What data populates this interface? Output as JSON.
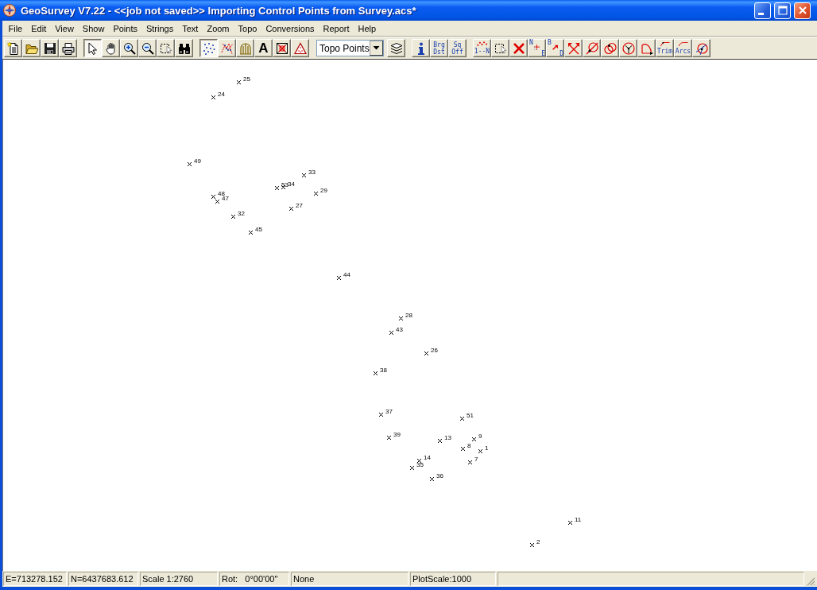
{
  "window": {
    "title": "GeoSurvey V7.22 - <<job not saved>> Importing Control Points from Survey.acs*"
  },
  "menu": [
    "File",
    "Edit",
    "View",
    "Show",
    "Points",
    "Strings",
    "Text",
    "Zoom",
    "Topo",
    "Conversions",
    "Report",
    "Help"
  ],
  "toolbar": {
    "groups": [
      {
        "items": [
          {
            "kind": "new",
            "pressed": false
          },
          {
            "kind": "open",
            "pressed": false
          },
          {
            "kind": "save",
            "pressed": false
          },
          {
            "kind": "print",
            "pressed": false
          }
        ]
      },
      {
        "items": [
          {
            "kind": "select",
            "pressed": true
          },
          {
            "kind": "pan",
            "pressed": false
          },
          {
            "kind": "zoomin",
            "pressed": false
          },
          {
            "kind": "zoomout",
            "pressed": false
          },
          {
            "kind": "zoomwindow",
            "pressed": false
          },
          {
            "kind": "find",
            "pressed": false
          }
        ]
      },
      {
        "items": [
          {
            "kind": "points",
            "pressed": true
          },
          {
            "kind": "strings",
            "pressed": false
          },
          {
            "kind": "topo",
            "pressed": false
          },
          {
            "kind": "text",
            "pressed": false,
            "text": [
              "A"
            ]
          },
          {
            "kind": "delete",
            "pressed": false
          },
          {
            "kind": "triangle",
            "pressed": false
          }
        ]
      },
      {
        "items": [
          {
            "kind": "dropdown",
            "value": "Topo Points"
          },
          {
            "kind": "layers",
            "pressed": false
          }
        ]
      },
      {
        "items": [
          {
            "kind": "info",
            "pressed": false
          },
          {
            "kind": "brgdst",
            "pressed": false,
            "text": [
              "Brg",
              "Dst"
            ]
          },
          {
            "kind": "sqoff",
            "pressed": false,
            "text": [
              "Sq",
              "Off"
            ]
          }
        ]
      },
      {
        "items": [
          {
            "kind": "renumber",
            "pressed": false,
            "text": [
              "1--N"
            ]
          },
          {
            "kind": "selectwindow",
            "pressed": false
          },
          {
            "kind": "deletex",
            "pressed": false
          },
          {
            "kind": "ne",
            "pressed": false,
            "text": [
              "N",
              "E"
            ]
          },
          {
            "kind": "bd",
            "pressed": false,
            "text": [
              "B",
              "D"
            ]
          },
          {
            "kind": "intersect",
            "pressed": false
          },
          {
            "kind": "circleline",
            "pressed": false
          },
          {
            "kind": "circles",
            "pressed": false
          },
          {
            "kind": "circle3",
            "pressed": false
          },
          {
            "kind": "arc",
            "pressed": false
          },
          {
            "kind": "trim",
            "pressed": false,
            "text": [
              "Trim"
            ]
          },
          {
            "kind": "arcs",
            "pressed": false,
            "text": [
              "Arcs"
            ]
          },
          {
            "kind": "tangent",
            "pressed": false
          }
        ]
      }
    ]
  },
  "canvas": {
    "points": [
      {
        "label": "25"
      },
      {
        "label": "24"
      },
      {
        "label": "49"
      },
      {
        "label": "33"
      },
      {
        "label": "53"
      },
      {
        "label": "34"
      },
      {
        "label": "29"
      },
      {
        "label": "48"
      },
      {
        "label": "47"
      },
      {
        "label": "27"
      },
      {
        "label": "32"
      },
      {
        "label": "45"
      },
      {
        "label": "44"
      },
      {
        "label": "28"
      },
      {
        "label": "43"
      },
      {
        "label": "26"
      },
      {
        "label": "38"
      },
      {
        "label": "37"
      },
      {
        "label": "51"
      },
      {
        "label": "39"
      },
      {
        "label": "13"
      },
      {
        "label": "9"
      },
      {
        "label": "8"
      },
      {
        "label": "1"
      },
      {
        "label": "14"
      },
      {
        "label": "35"
      },
      {
        "label": "7"
      },
      {
        "label": "36"
      },
      {
        "label": "11"
      },
      {
        "label": "2"
      }
    ]
  },
  "status_bar": [
    "E=713278.152",
    "N=6437683.612",
    "Scale 1:2760",
    "Rot:   0°00'00\"",
    "None",
    "PlotScale:1000"
  ]
}
